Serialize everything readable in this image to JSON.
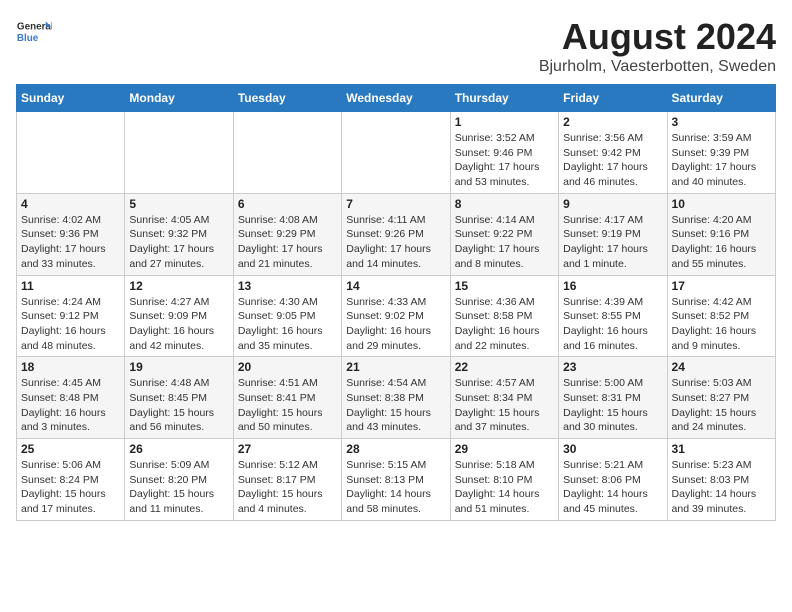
{
  "header": {
    "logo_line1": "General",
    "logo_line2": "Blue",
    "title": "August 2024",
    "subtitle": "Bjurholm, Vaesterbotten, Sweden"
  },
  "weekdays": [
    "Sunday",
    "Monday",
    "Tuesday",
    "Wednesday",
    "Thursday",
    "Friday",
    "Saturday"
  ],
  "weeks": [
    [
      {
        "day": "",
        "info": ""
      },
      {
        "day": "",
        "info": ""
      },
      {
        "day": "",
        "info": ""
      },
      {
        "day": "",
        "info": ""
      },
      {
        "day": "1",
        "info": "Sunrise: 3:52 AM\nSunset: 9:46 PM\nDaylight: 17 hours\nand 53 minutes."
      },
      {
        "day": "2",
        "info": "Sunrise: 3:56 AM\nSunset: 9:42 PM\nDaylight: 17 hours\nand 46 minutes."
      },
      {
        "day": "3",
        "info": "Sunrise: 3:59 AM\nSunset: 9:39 PM\nDaylight: 17 hours\nand 40 minutes."
      }
    ],
    [
      {
        "day": "4",
        "info": "Sunrise: 4:02 AM\nSunset: 9:36 PM\nDaylight: 17 hours\nand 33 minutes."
      },
      {
        "day": "5",
        "info": "Sunrise: 4:05 AM\nSunset: 9:32 PM\nDaylight: 17 hours\nand 27 minutes."
      },
      {
        "day": "6",
        "info": "Sunrise: 4:08 AM\nSunset: 9:29 PM\nDaylight: 17 hours\nand 21 minutes."
      },
      {
        "day": "7",
        "info": "Sunrise: 4:11 AM\nSunset: 9:26 PM\nDaylight: 17 hours\nand 14 minutes."
      },
      {
        "day": "8",
        "info": "Sunrise: 4:14 AM\nSunset: 9:22 PM\nDaylight: 17 hours\nand 8 minutes."
      },
      {
        "day": "9",
        "info": "Sunrise: 4:17 AM\nSunset: 9:19 PM\nDaylight: 17 hours\nand 1 minute."
      },
      {
        "day": "10",
        "info": "Sunrise: 4:20 AM\nSunset: 9:16 PM\nDaylight: 16 hours\nand 55 minutes."
      }
    ],
    [
      {
        "day": "11",
        "info": "Sunrise: 4:24 AM\nSunset: 9:12 PM\nDaylight: 16 hours\nand 48 minutes."
      },
      {
        "day": "12",
        "info": "Sunrise: 4:27 AM\nSunset: 9:09 PM\nDaylight: 16 hours\nand 42 minutes."
      },
      {
        "day": "13",
        "info": "Sunrise: 4:30 AM\nSunset: 9:05 PM\nDaylight: 16 hours\nand 35 minutes."
      },
      {
        "day": "14",
        "info": "Sunrise: 4:33 AM\nSunset: 9:02 PM\nDaylight: 16 hours\nand 29 minutes."
      },
      {
        "day": "15",
        "info": "Sunrise: 4:36 AM\nSunset: 8:58 PM\nDaylight: 16 hours\nand 22 minutes."
      },
      {
        "day": "16",
        "info": "Sunrise: 4:39 AM\nSunset: 8:55 PM\nDaylight: 16 hours\nand 16 minutes."
      },
      {
        "day": "17",
        "info": "Sunrise: 4:42 AM\nSunset: 8:52 PM\nDaylight: 16 hours\nand 9 minutes."
      }
    ],
    [
      {
        "day": "18",
        "info": "Sunrise: 4:45 AM\nSunset: 8:48 PM\nDaylight: 16 hours\nand 3 minutes."
      },
      {
        "day": "19",
        "info": "Sunrise: 4:48 AM\nSunset: 8:45 PM\nDaylight: 15 hours\nand 56 minutes."
      },
      {
        "day": "20",
        "info": "Sunrise: 4:51 AM\nSunset: 8:41 PM\nDaylight: 15 hours\nand 50 minutes."
      },
      {
        "day": "21",
        "info": "Sunrise: 4:54 AM\nSunset: 8:38 PM\nDaylight: 15 hours\nand 43 minutes."
      },
      {
        "day": "22",
        "info": "Sunrise: 4:57 AM\nSunset: 8:34 PM\nDaylight: 15 hours\nand 37 minutes."
      },
      {
        "day": "23",
        "info": "Sunrise: 5:00 AM\nSunset: 8:31 PM\nDaylight: 15 hours\nand 30 minutes."
      },
      {
        "day": "24",
        "info": "Sunrise: 5:03 AM\nSunset: 8:27 PM\nDaylight: 15 hours\nand 24 minutes."
      }
    ],
    [
      {
        "day": "25",
        "info": "Sunrise: 5:06 AM\nSunset: 8:24 PM\nDaylight: 15 hours\nand 17 minutes."
      },
      {
        "day": "26",
        "info": "Sunrise: 5:09 AM\nSunset: 8:20 PM\nDaylight: 15 hours\nand 11 minutes."
      },
      {
        "day": "27",
        "info": "Sunrise: 5:12 AM\nSunset: 8:17 PM\nDaylight: 15 hours\nand 4 minutes."
      },
      {
        "day": "28",
        "info": "Sunrise: 5:15 AM\nSunset: 8:13 PM\nDaylight: 14 hours\nand 58 minutes."
      },
      {
        "day": "29",
        "info": "Sunrise: 5:18 AM\nSunset: 8:10 PM\nDaylight: 14 hours\nand 51 minutes."
      },
      {
        "day": "30",
        "info": "Sunrise: 5:21 AM\nSunset: 8:06 PM\nDaylight: 14 hours\nand 45 minutes."
      },
      {
        "day": "31",
        "info": "Sunrise: 5:23 AM\nSunset: 8:03 PM\nDaylight: 14 hours\nand 39 minutes."
      }
    ]
  ]
}
